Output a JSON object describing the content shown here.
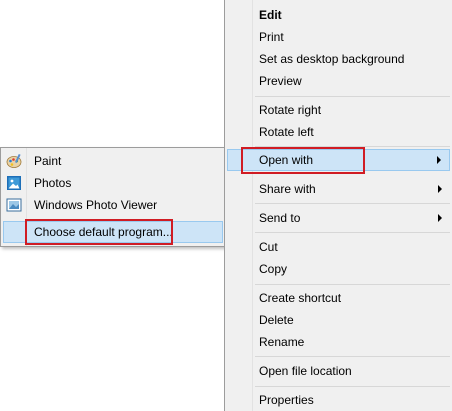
{
  "context_menu": {
    "items": {
      "edit": "Edit",
      "print": "Print",
      "set_desktop_bg": "Set as desktop background",
      "preview": "Preview",
      "rotate_right": "Rotate right",
      "rotate_left": "Rotate left",
      "open_with": "Open with",
      "share_with": "Share with",
      "send_to": "Send to",
      "cut": "Cut",
      "copy": "Copy",
      "create_shortcut": "Create shortcut",
      "delete": "Delete",
      "rename": "Rename",
      "open_file_location": "Open file location",
      "properties": "Properties"
    }
  },
  "open_with_submenu": {
    "items": {
      "paint": "Paint",
      "photos": "Photos",
      "windows_photo_viewer": "Windows Photo Viewer",
      "choose_default": "Choose default program..."
    },
    "icons": {
      "paint": "paint-palette-icon",
      "photos": "photos-icon",
      "windows_photo_viewer": "photo-viewer-icon"
    }
  },
  "colors": {
    "menu_bg": "#f0f0f0",
    "highlight_bg": "#cde4f7",
    "highlight_border": "#99c9ef",
    "annotation_red": "#d01c24"
  }
}
